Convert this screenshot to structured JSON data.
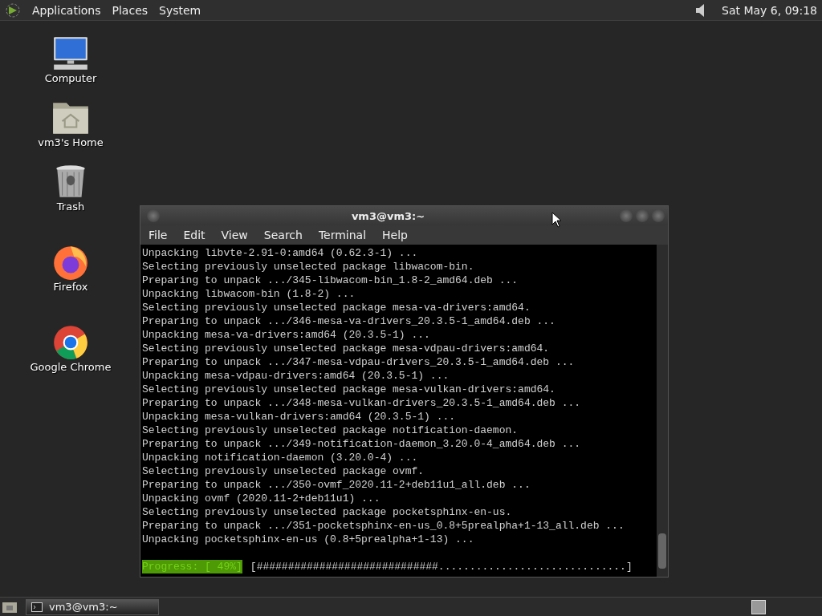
{
  "top_panel": {
    "menus": [
      "Applications",
      "Places",
      "System"
    ],
    "clock": "Sat May  6, 09:18"
  },
  "desktop_icons": [
    {
      "kind": "computer",
      "label": "Computer"
    },
    {
      "kind": "home",
      "label": "vm3's Home"
    },
    {
      "kind": "trash",
      "label": "Trash"
    },
    {
      "kind": "firefox",
      "label": "Firefox"
    },
    {
      "kind": "chrome",
      "label": "Google Chrome"
    }
  ],
  "terminal": {
    "title": "vm3@vm3:~",
    "menu": [
      "File",
      "Edit",
      "View",
      "Search",
      "Terminal",
      "Help"
    ],
    "lines": [
      "Unpacking libvte-2.91-0:amd64 (0.62.3-1) ...",
      "Selecting previously unselected package libwacom-bin.",
      "Preparing to unpack .../345-libwacom-bin_1.8-2_amd64.deb ...",
      "Unpacking libwacom-bin (1.8-2) ...",
      "Selecting previously unselected package mesa-va-drivers:amd64.",
      "Preparing to unpack .../346-mesa-va-drivers_20.3.5-1_amd64.deb ...",
      "Unpacking mesa-va-drivers:amd64 (20.3.5-1) ...",
      "Selecting previously unselected package mesa-vdpau-drivers:amd64.",
      "Preparing to unpack .../347-mesa-vdpau-drivers_20.3.5-1_amd64.deb ...",
      "Unpacking mesa-vdpau-drivers:amd64 (20.3.5-1) ...",
      "Selecting previously unselected package mesa-vulkan-drivers:amd64.",
      "Preparing to unpack .../348-mesa-vulkan-drivers_20.3.5-1_amd64.deb ...",
      "Unpacking mesa-vulkan-drivers:amd64 (20.3.5-1) ...",
      "Selecting previously unselected package notification-daemon.",
      "Preparing to unpack .../349-notification-daemon_3.20.0-4_amd64.deb ...",
      "Unpacking notification-daemon (3.20.0-4) ...",
      "Selecting previously unselected package ovmf.",
      "Preparing to unpack .../350-ovmf_2020.11-2+deb11u1_all.deb ...",
      "Unpacking ovmf (2020.11-2+deb11u1) ...",
      "Selecting previously unselected package pocketsphinx-en-us.",
      "Preparing to unpack .../351-pocketsphinx-en-us_0.8+5prealpha+1-13_all.deb ...",
      "Unpacking pocketsphinx-en-us (0.8+5prealpha+1-13) ..."
    ],
    "progress_label": "Progress: [ 49%]",
    "progress_bar": "[#############################..............................]"
  },
  "taskbar": {
    "tasks": [
      {
        "label": "vm3@vm3:~",
        "selected": false
      }
    ]
  }
}
